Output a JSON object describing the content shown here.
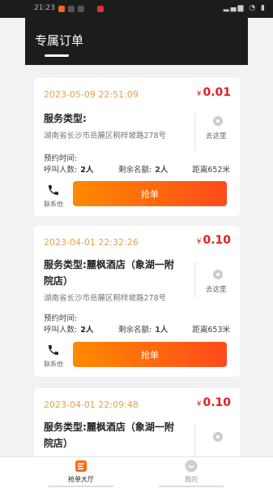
{
  "status_bar": {
    "time": "21:23"
  },
  "header": {
    "title": "专属订单"
  },
  "orders": [
    {
      "date": "2023-05-09 22:51:09",
      "currency": "¥",
      "price": "0.01",
      "service_label": "服务类型:",
      "service_name": "",
      "address": "湖南省长沙市岳麓区桐梓坡路278号",
      "goto_label": "去这里",
      "appointment_label": "预约时间:",
      "callers_label": "呼叫人数:",
      "callers_value": "2人",
      "remaining_label": "剩余名额:",
      "remaining_value": "2人",
      "distance": "距离652米",
      "contact_label": "联系他",
      "grab_label": "抢单"
    },
    {
      "date": "2023-04-01 22:32:26",
      "currency": "¥",
      "price": "0.10",
      "service_label": "服务类型:",
      "service_name_line1": "麗枫酒店（象湖一附",
      "service_name_line2": "院店）",
      "address": "湖南省长沙市岳麓区桐梓坡路278号",
      "goto_label": "去这里",
      "appointment_label": "预约时间:",
      "callers_label": "呼叫人数:",
      "callers_value": "2人",
      "remaining_label": "剩余名额:",
      "remaining_value": "1人",
      "distance": "距离653米",
      "contact_label": "联系他",
      "grab_label": "抢单"
    },
    {
      "date": "2023-04-01 22:09:48",
      "currency": "¥",
      "price": "0.10",
      "service_label": "服务类型:",
      "service_name_line1": "麗枫酒店（象湖一附",
      "service_name_line2": "院店）"
    }
  ],
  "tabbar": {
    "tabs": [
      {
        "label": "抢单大厅",
        "icon": "order-hall-icon",
        "active": true
      },
      {
        "label": "我的",
        "icon": "profile-icon",
        "active": false
      }
    ]
  },
  "colors": {
    "accent_orange": "#ff6a10",
    "price_red": "#e02020",
    "date_orange": "#e8a04a",
    "header_bg": "#1c1c1c"
  }
}
